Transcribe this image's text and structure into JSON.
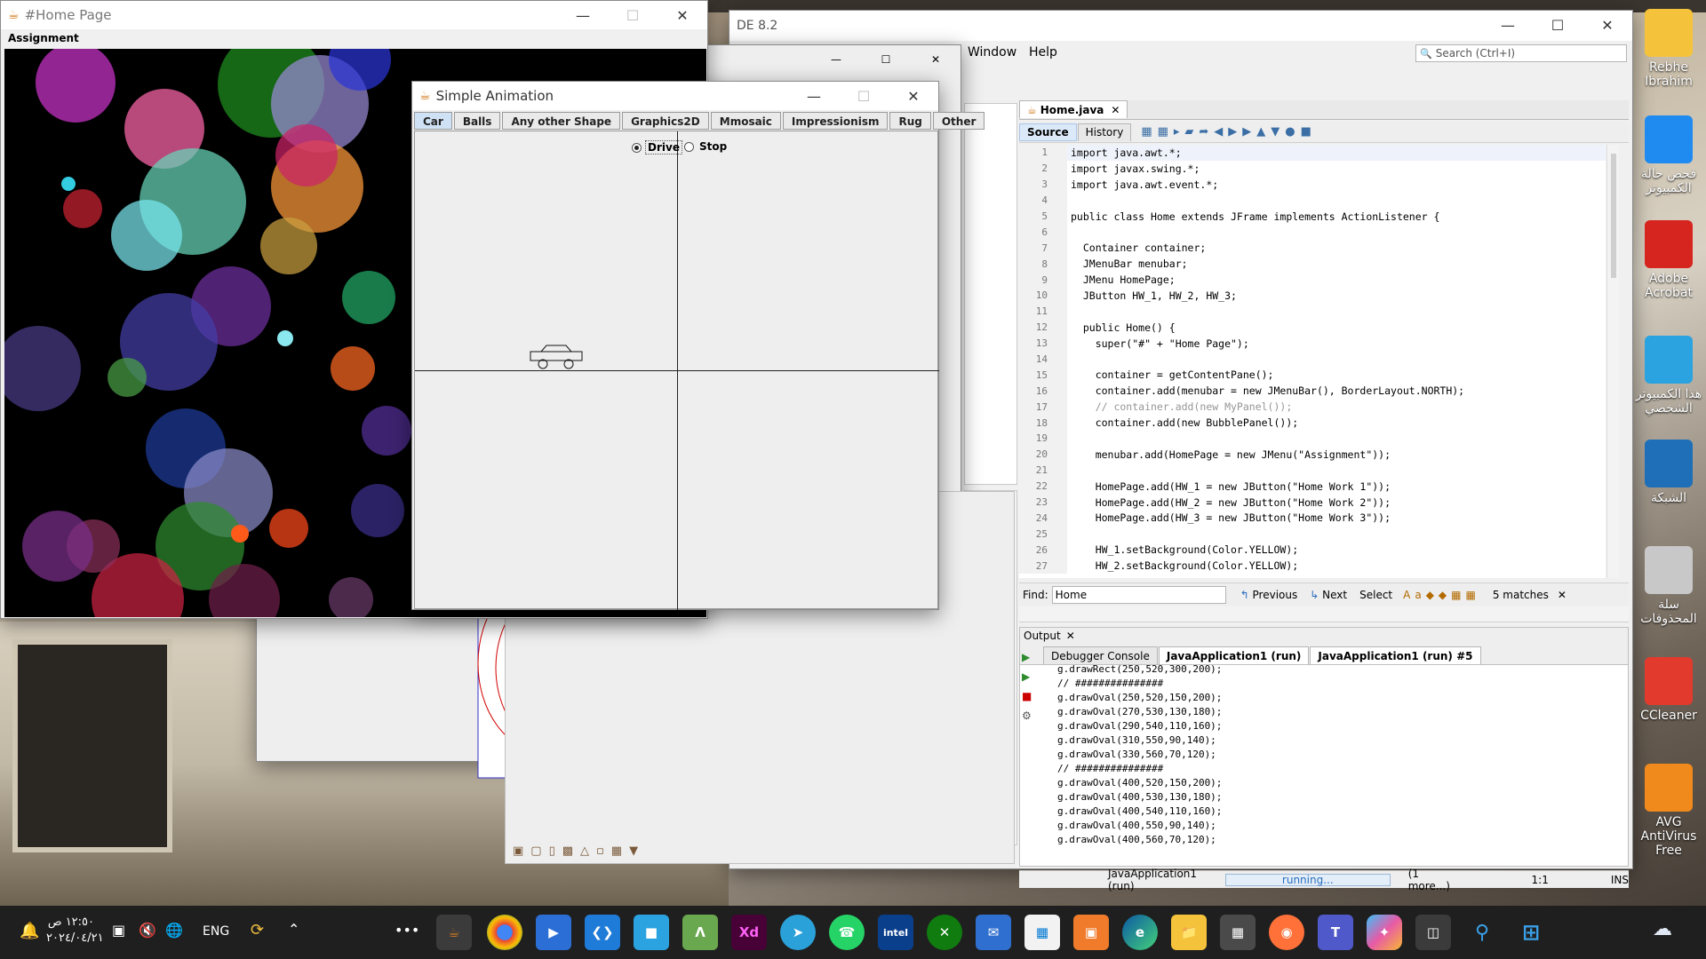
{
  "home_window": {
    "title": "#Home Page",
    "menu": "Assignment"
  },
  "netbeans": {
    "title_fragment": "DE 8.2",
    "menus": [
      "Window",
      "Help"
    ],
    "search_placeholder": "Search (Ctrl+I)",
    "editor_tab": "Home.java",
    "view_tabs": [
      "Source",
      "History"
    ],
    "code_lines": [
      {
        "n": "1",
        "t": "import java.awt.*;"
      },
      {
        "n": "2",
        "t": "import javax.swing.*;"
      },
      {
        "n": "3",
        "t": "import java.awt.event.*;"
      },
      {
        "n": "4",
        "t": ""
      },
      {
        "n": "5",
        "t": "public class Home extends JFrame implements ActionListener {"
      },
      {
        "n": "6",
        "t": ""
      },
      {
        "n": "7",
        "t": "  Container container;"
      },
      {
        "n": "8",
        "t": "  JMenuBar menubar;"
      },
      {
        "n": "9",
        "t": "  JMenu HomePage;"
      },
      {
        "n": "10",
        "t": "  JButton HW_1, HW_2, HW_3;"
      },
      {
        "n": "11",
        "t": ""
      },
      {
        "n": "12",
        "t": "  public Home() {"
      },
      {
        "n": "13",
        "t": "    super(\"#\" + \"Home Page\");"
      },
      {
        "n": "14",
        "t": ""
      },
      {
        "n": "15",
        "t": "    container = getContentPane();"
      },
      {
        "n": "16",
        "t": "    container.add(menubar = new JMenuBar(), BorderLayout.NORTH);"
      },
      {
        "n": "17",
        "t": "    // container.add(new MyPanel());"
      },
      {
        "n": "18",
        "t": "    container.add(new BubblePanel());"
      },
      {
        "n": "19",
        "t": ""
      },
      {
        "n": "20",
        "t": "    menubar.add(HomePage = new JMenu(\"Assignment\"));"
      },
      {
        "n": "21",
        "t": ""
      },
      {
        "n": "22",
        "t": "    HomePage.add(HW_1 = new JButton(\"Home Work 1\"));"
      },
      {
        "n": "23",
        "t": "    HomePage.add(HW_2 = new JButton(\"Home Work 2\"));"
      },
      {
        "n": "24",
        "t": "    HomePage.add(HW_3 = new JButton(\"Home Work 3\"));"
      },
      {
        "n": "25",
        "t": ""
      },
      {
        "n": "26",
        "t": "    HW_1.setBackground(Color.YELLOW);"
      },
      {
        "n": "27",
        "t": "    HW_2.setBackground(Color.YELLOW);"
      }
    ],
    "find": {
      "label": "Find:",
      "value": "Home",
      "previous": "Previous",
      "next": "Next",
      "select": "Select",
      "matches": "5 matches"
    },
    "output": {
      "title": "Output",
      "tabs": [
        "Debugger Console",
        "JavaApplication1 (run)",
        "JavaApplication1 (run) #5"
      ],
      "lines": [
        "g.drawRect(250,520,300,200);",
        "// ###############",
        "g.drawOval(250,520,150,200);",
        "g.drawOval(270,530,130,180);",
        "g.drawOval(290,540,110,160);",
        "g.drawOval(310,550,90,140);",
        "g.drawOval(330,560,70,120);",
        "// ###############",
        "g.drawOval(400,520,150,200);",
        "g.drawOval(400,530,130,180);",
        "g.drawOval(400,540,110,160);",
        "g.drawOval(400,550,90,140);",
        "g.drawOval(400,560,70,120);"
      ]
    },
    "status": {
      "app": "JavaApplication1 (run)",
      "progress_label": "running...",
      "more": "(1 more...)",
      "pos": "1:1",
      "mode": "INS"
    }
  },
  "simple_animation": {
    "title": "Simple Animation",
    "tabs": [
      "Car",
      "Balls",
      "Any other Shape",
      "Graphics2D",
      "Mmosaic",
      "Impressionism",
      "Rug",
      "Other"
    ],
    "radios": {
      "drive": "Drive",
      "stop": "Stop",
      "selected": "drive"
    }
  },
  "desktop_icons": [
    {
      "label": "Rebhe Ibrahim",
      "icon": "user-folder-icon"
    },
    {
      "label": "فحص حالة الكمبيوتر",
      "icon": "health-check-icon"
    },
    {
      "label": "Adobe Acrobat",
      "icon": "acrobat-icon"
    },
    {
      "label": "هذا الكمبيوتر الشخصي",
      "icon": "computer-icon"
    },
    {
      "label": "الشبكة",
      "icon": "network-icon"
    },
    {
      "label": "سلة المحذوفات",
      "icon": "recycle-bin-icon"
    },
    {
      "label": "CCleaner",
      "icon": "ccleaner-icon"
    },
    {
      "label": "AVG AntiVirus Free",
      "icon": "avg-icon"
    }
  ],
  "taskbar": {
    "time": "١٢:٥٠ ص",
    "date": "٢٠٢٤/٠٤/٢١",
    "lang": "ENG",
    "more": "•••"
  }
}
